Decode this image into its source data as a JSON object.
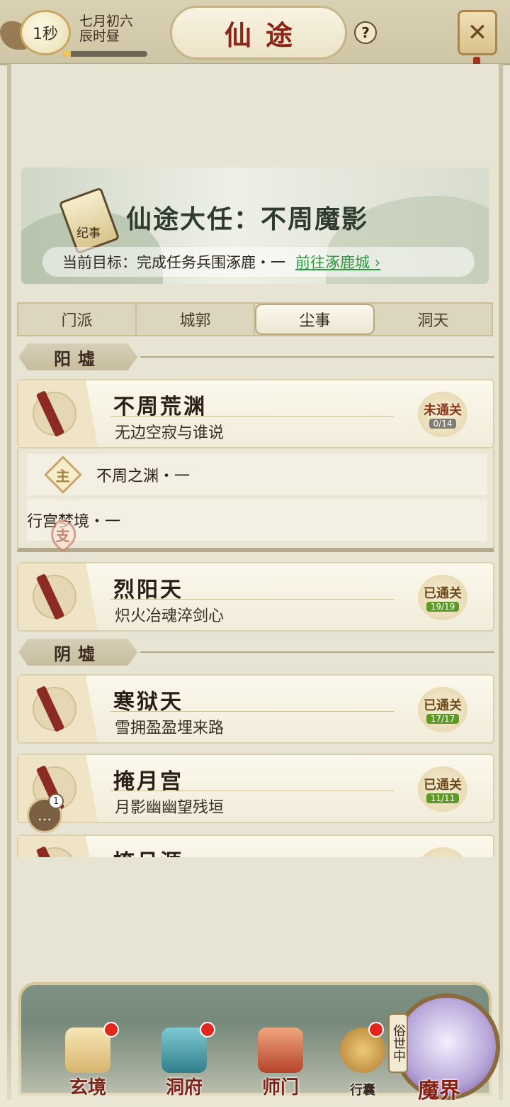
{
  "header": {
    "timer": "1秒",
    "date_line1": "七月初六",
    "date_line2": "辰时昼",
    "time_progress": 0.1,
    "title": "仙途",
    "help": "?",
    "close_icon": "crossed-swords-icon"
  },
  "banner": {
    "book_label": "纪事",
    "title": "仙途大任：不周魔影",
    "objective": "当前目标：完成任务兵围涿鹿・一",
    "goto": "前往涿鹿城"
  },
  "tabs": [
    "门派",
    "城郭",
    "尘事",
    "洞天"
  ],
  "active_tab": "尘事",
  "sections": {
    "yang": "阳墟",
    "yin": "阴墟"
  },
  "cards": [
    {
      "name": "不周荒渊",
      "sub": "无边空寂与谁说",
      "status": "未通关",
      "count": "0/14"
    },
    {
      "name": "烈阳天",
      "sub": "炽火冶魂淬剑心",
      "status": "已通关",
      "count": "19/19"
    },
    {
      "name": "寒狱天",
      "sub": "雪拥盈盈埋来路",
      "status": "已通关",
      "count": "17/17"
    },
    {
      "name": "掩月宫",
      "sub": "月影幽幽望残垣",
      "status": "已通关",
      "count": "11/11"
    },
    {
      "name": "掩月涯"
    }
  ],
  "subquests": [
    {
      "badge": "主",
      "text": "不周之渊・一"
    },
    {
      "badge": "支",
      "text": "行宫梦境・一"
    }
  ],
  "chat": {
    "count": "1"
  },
  "nav": {
    "items": [
      "玄境",
      "洞府",
      "师门",
      "行囊"
    ],
    "portal_side": "俗世中",
    "portal_label": "魔界"
  }
}
